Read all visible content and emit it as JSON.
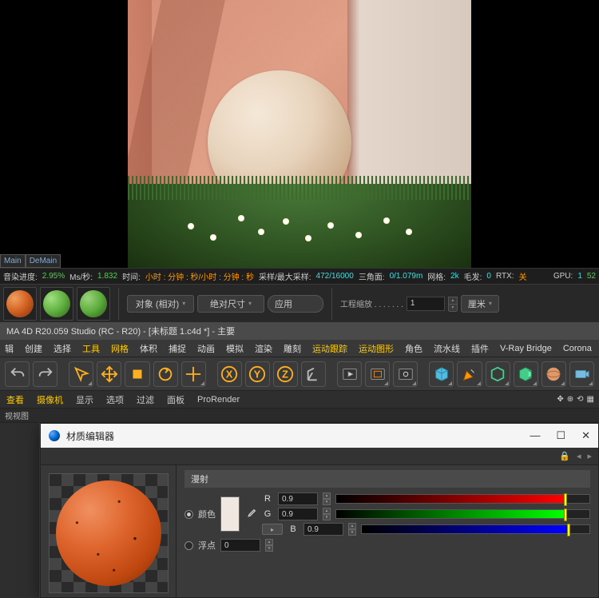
{
  "viewport": {
    "main_tab": "Main",
    "demain_tab": "DeMain"
  },
  "status": {
    "render_label": "音染进度:",
    "render_value": "2.95%",
    "ms_label": "Ms/秒:",
    "ms_value": "1.832",
    "time_label": "时间:",
    "time_value": "小时 : 分钟 : 秒/小时 : 分钟 : 秒",
    "sample_label": "采样/最大采样:",
    "sample_value": "472/16000",
    "tri_label": "三角面:",
    "tri_value": "0/1.079m",
    "grid_label": "网格:",
    "grid_value": "2k",
    "hair_label": "毛发:",
    "hair_value": "0",
    "rtx_label": "RTX:",
    "rtx_value": "关",
    "gpu_label": "GPU:",
    "gpu_id": "1",
    "gpu_value": "52"
  },
  "matrow": {
    "object_mode": "对象 (相对)",
    "size_mode": "绝对尺寸",
    "apply": "应用",
    "scale_label": "工程缩放 . . . . . . .",
    "scale_value": "1",
    "unit": "厘米"
  },
  "window_title": "MA 4D R20.059 Studio (RC - R20) - [未标题 1.c4d *] - 主要",
  "menu": {
    "edit": "辑",
    "create": "创建",
    "select": "选择",
    "tools": "工具",
    "mesh": "网格",
    "volume": "体积",
    "snap": "捕捉",
    "anim": "动画",
    "sim": "模拟",
    "render": "渲染",
    "sculpt": "雕刻",
    "track": "运动跟踪",
    "mograph": "运动图形",
    "char": "角色",
    "pipeline": "流水线",
    "plugin": "插件",
    "vray": "V-Ray Bridge",
    "corona": "Corona"
  },
  "viewtabs": {
    "view": "查看",
    "camera": "摄像机",
    "display": "显示",
    "options": "选项",
    "filter": "过滤",
    "panel": "面板",
    "prorender": "ProRender",
    "sub_label": "视视图"
  },
  "material_editor": {
    "title": "材质编辑器",
    "section": "漫射",
    "color_label": "颜色",
    "float_label": "浮点",
    "channels": {
      "r": "R",
      "g": "G",
      "b": "B"
    },
    "values": {
      "r": "0.9",
      "g": "0.9",
      "b": "0.9",
      "float": "0"
    }
  }
}
